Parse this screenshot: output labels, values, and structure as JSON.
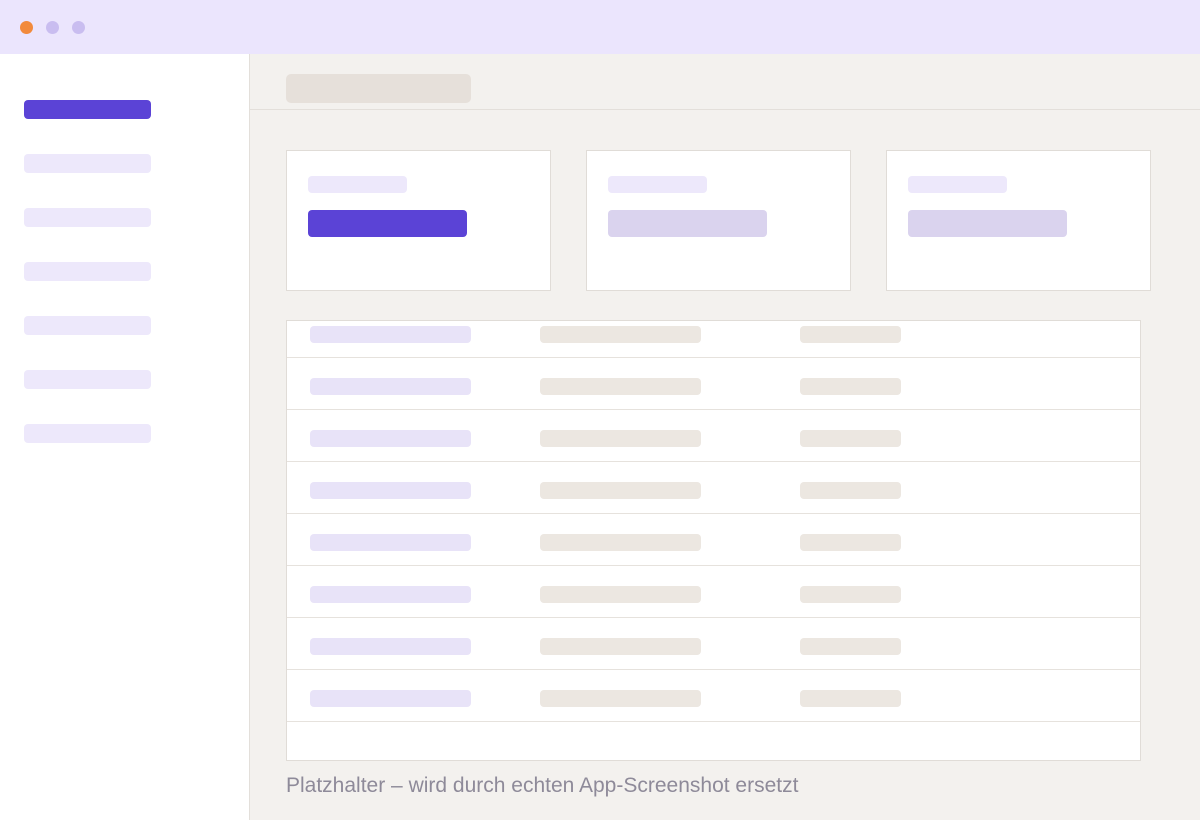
{
  "window": {
    "controls": [
      {
        "name": "close-dot",
        "color": "#f28a3c"
      },
      {
        "name": "minimize-dot",
        "color": "#c9bdf0"
      },
      {
        "name": "maximize-dot",
        "color": "#c9bdf0"
      }
    ]
  },
  "colors": {
    "accent": "#5b43d6",
    "titlebar": "#ebe5fd",
    "background": "#f3f1ee"
  },
  "sidebar": {
    "active_index": 0,
    "item_count": 7
  },
  "table": {
    "row_count": 8
  },
  "caption": "Platzhalter – wird durch echten App-Screenshot ersetzt"
}
